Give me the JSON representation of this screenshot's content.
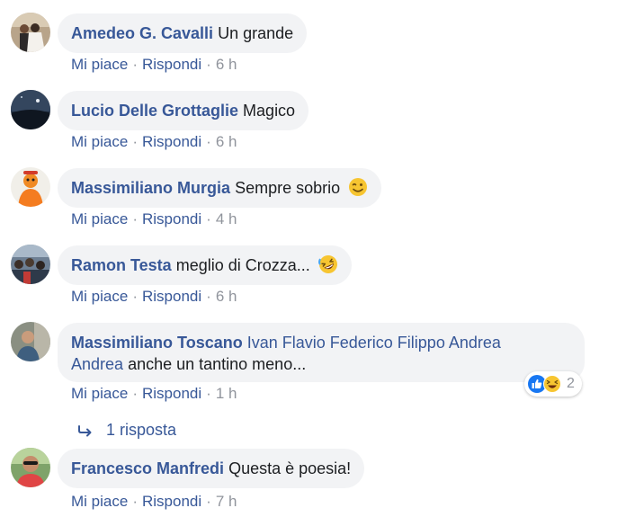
{
  "comments": [
    {
      "author": "Amedeo G. Cavalli",
      "text": "Un grande",
      "like": "Mi piace",
      "reply": "Rispondi",
      "time": "6 h",
      "avatar_icon": "wedding-photo-avatar"
    },
    {
      "author": "Lucio Delle Grottaglie",
      "text": "Magico",
      "like": "Mi piace",
      "reply": "Rispondi",
      "time": "6 h",
      "avatar_icon": "night-sky-avatar"
    },
    {
      "author": "Massimiliano Murgia",
      "text": "Sempre sobrio",
      "emoji": "wink-emoji",
      "like": "Mi piace",
      "reply": "Rispondi",
      "time": "4 h",
      "avatar_icon": "orange-cartoon-avatar"
    },
    {
      "author": "Ramon Testa",
      "text": "meglio di Crozza...",
      "emoji": "rolling-laughing-emoji",
      "like": "Mi piace",
      "reply": "Rispondi",
      "time": "6 h",
      "avatar_icon": "crowd-photo-avatar"
    },
    {
      "author": "Massimiliano Toscano",
      "mention_line1": "Ivan Flavio Federico Filippo Andrea",
      "mention_line2": "Andrea",
      "text": "anche un tantino meno...",
      "like": "Mi piace",
      "reply": "Rispondi",
      "time": "1 h",
      "reactions": {
        "icons": [
          "like-reaction-icon",
          "haha-reaction-icon"
        ],
        "count": "2"
      },
      "replies_label": "1 risposta",
      "avatar_icon": "man-portrait-avatar"
    },
    {
      "author": "Francesco Manfredi",
      "text": "Questa è poesia!",
      "like": "Mi piace",
      "reply": "Rispondi",
      "time": "7 h",
      "avatar_icon": "man-sunglasses-avatar"
    }
  ],
  "colors": {
    "author": "#385898",
    "bubble": "#f2f3f5",
    "meta": "#90949c",
    "like_blue": "#1877f2",
    "emoji_yellow": "#f7c531"
  },
  "separator": "·"
}
